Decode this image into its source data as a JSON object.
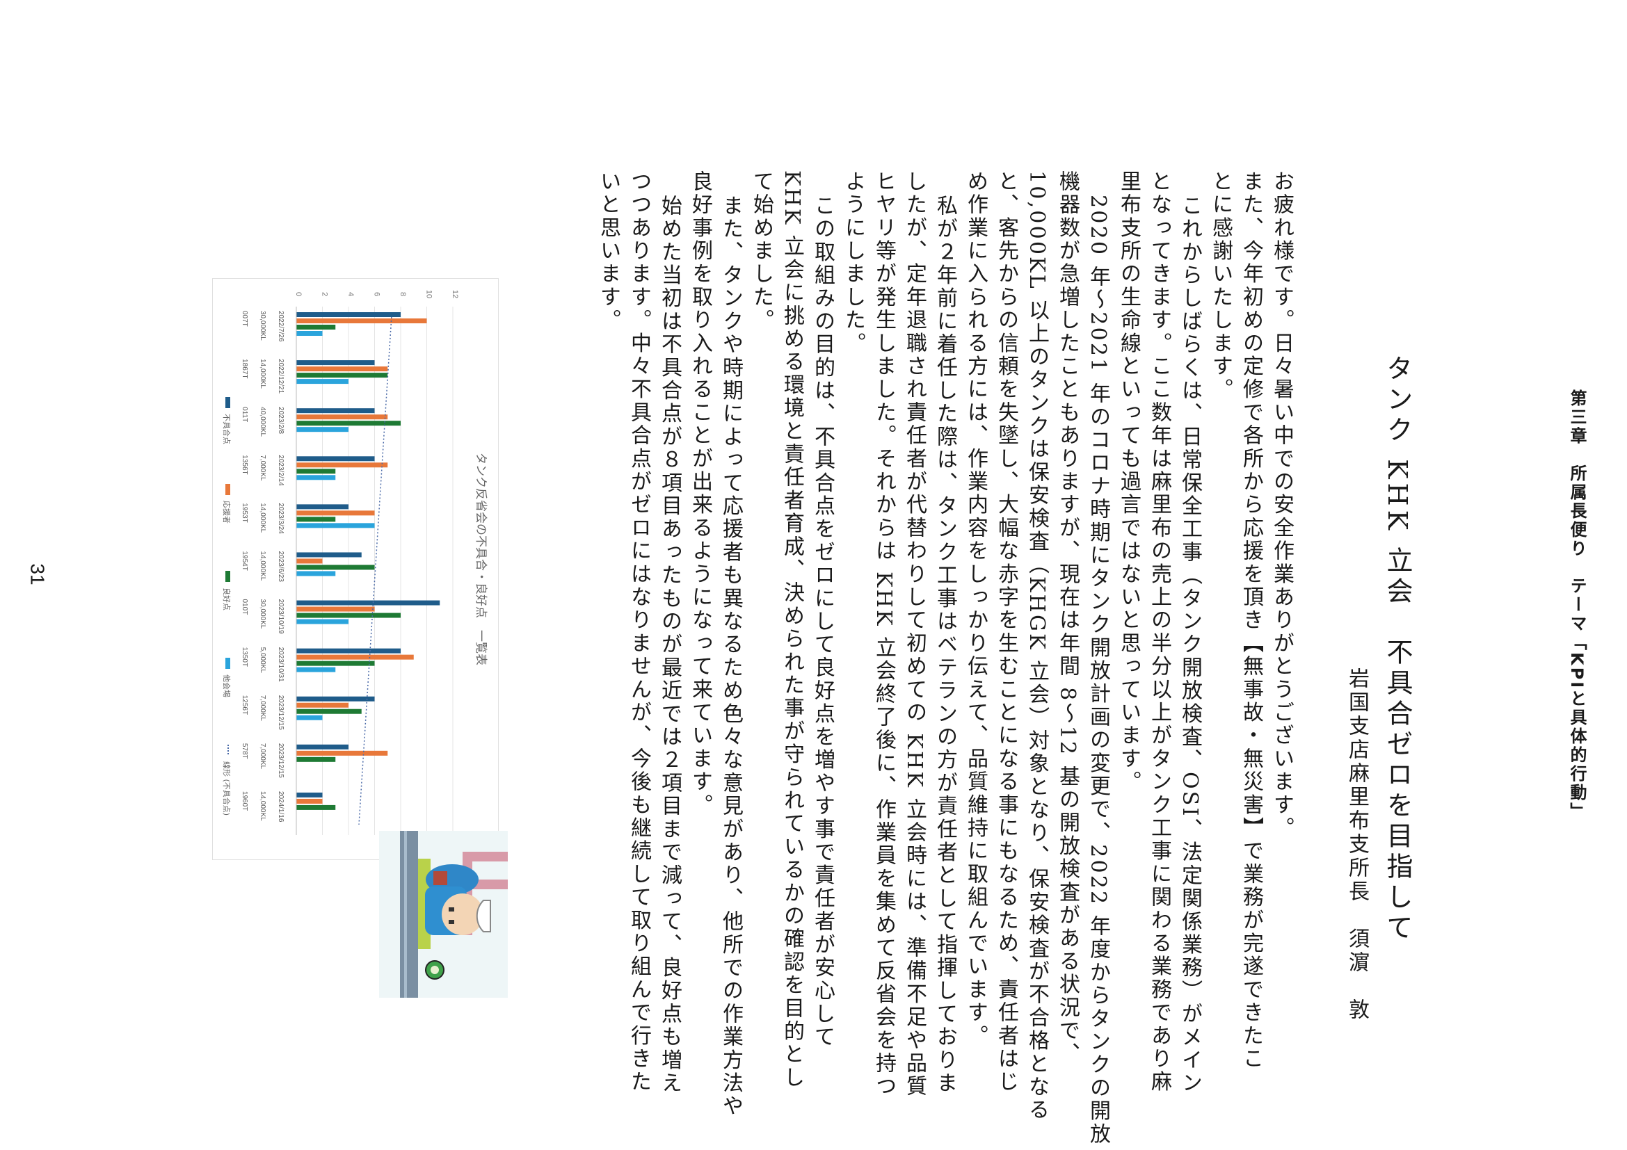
{
  "page": {
    "header": "第三章　所属長便り　テーマ「KPIと具体的行動」",
    "title": "タンク KHK 立会　不具合ゼロを目指して",
    "author": "岩国支店麻里布支所長　須濵　敦",
    "page_number": "31"
  },
  "body_lines": [
    "お疲れ様です。日々暑い中での安全作業ありがとうございます。",
    "また、今年初めの定修で各所から応援を頂き【無事故・無災害】で業務が完遂できたこ",
    "とに感謝いたします。",
    "これからしばらくは、日常保全工事（タンク開放検査、OSI、法定関係業務）がメイン",
    "となってきます。ここ数年は麻里布の売上の半分以上がタンク工事に関わる業務であり麻",
    "里布支所の生命線といっても過言ではないと思っています。",
    "2020 年〜2021 年のコロナ時期にタンク開放計画の変更で、2022 年度からタンクの開放",
    "機器数が急増したこともありますが、現在は年間 8〜12 基の開放検査がある状況で、",
    "10,000KL 以上のタンクは保安検査（KHGK 立会）対象となり、保安検査が不合格となる",
    "と、客先からの信頼を失墜し、大幅な赤字を生むことになる事にもなるため、責任者はじ",
    "め作業に入られる方には、作業内容をしっかり伝えて、品質維持に取組んでいます。",
    "私が２年前に着任した際は、タンク工事はベテランの方が責任者として指揮しておりま",
    "したが、定年退職され責任者が代替わりして初めての KHK 立会時には、準備不足や品質",
    "ヒヤリ等が発生しました。それからは KHK 立会終了後に、作業員を集めて反省会を持つ",
    "ようにしました。",
    "この取組みの目的は、不具合点をゼロにして良好点を増やす事で責任者が安心して",
    "KHK 立会に挑める環境と責任者育成、決められた事が守られているかの確認を目的とし",
    "て始めました。",
    "また、タンクや時期によって応援者も異なるため色々な意見があり、他所での作業方法や",
    "良好事例を取り入れることが出来るようになって来ています。",
    "始めた当初は不具合点が８項目あったものが最近では２項目まで減って、良好点も増え",
    "つつあります。中々不具合点がゼロにはなりませんが、今後も継続して取り組んで行きた",
    "いと思います。"
  ],
  "chart_data": {
    "type": "bar",
    "title": "タンク反省会の不具合・良好点　一覧表",
    "categories": [
      [
        "2022/7/26",
        "30,000KL",
        "007T"
      ],
      [
        "2022/12/21",
        "14,000KL",
        "1867T"
      ],
      [
        "2023/2/8",
        "40,000KL",
        "011T"
      ],
      [
        "2023/2/14",
        "7,000KL",
        "1356T"
      ],
      [
        "2023/3/24",
        "14,000KL",
        "1953T"
      ],
      [
        "2023/6/23",
        "14,000KL",
        "1954T"
      ],
      [
        "2023/10/19",
        "30,000KL",
        "010T"
      ],
      [
        "2023/10/31",
        "5,000KL",
        "1350T"
      ],
      [
        "2023/12/15",
        "7,000KL",
        "1256T"
      ],
      [
        "2023/12/15",
        "7,000KL",
        "578T"
      ],
      [
        "2024/1/16",
        "14,000KL",
        "1960T"
      ]
    ],
    "series": [
      {
        "name": "不具合点",
        "color": "#1f5c8a",
        "values": [
          8,
          6,
          6,
          6,
          4,
          5,
          11,
          8,
          6,
          4,
          2
        ]
      },
      {
        "name": "応援者",
        "color": "#e8783a",
        "values": [
          10,
          7,
          7,
          7,
          6,
          2,
          6,
          9,
          4,
          7,
          2
        ]
      },
      {
        "name": "良好点",
        "color": "#1e7a34",
        "values": [
          3,
          7,
          8,
          3,
          3,
          6,
          8,
          6,
          5,
          3,
          3
        ]
      },
      {
        "name": "他会場",
        "color": "#2aa4dc",
        "values": [
          2,
          4,
          4,
          3,
          6,
          3,
          4,
          3,
          2,
          0,
          0
        ]
      }
    ],
    "trendline": {
      "name": "線形 (不具合点)",
      "color": "#4a6aa8",
      "start": 7.3,
      "end": 4.8
    },
    "ylim": [
      0,
      12
    ],
    "yticks": [
      "0",
      "2",
      "4",
      "6",
      "8",
      "10",
      "12"
    ],
    "grid": true,
    "legend_position": "bottom"
  },
  "illustration": {
    "icon": "worker-inspecting-pipe-icon"
  }
}
